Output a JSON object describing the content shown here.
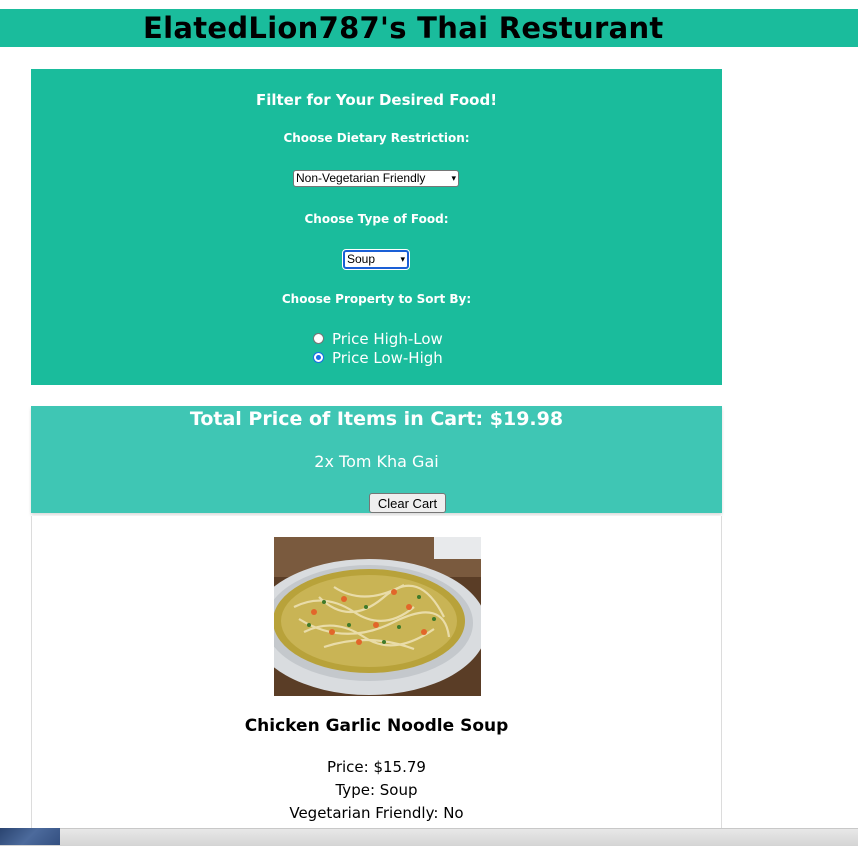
{
  "header": {
    "title": "ElatedLion787's Thai Resturant"
  },
  "filter": {
    "title": "Filter for Your Desired Food!",
    "diet_label": "Choose Dietary Restriction:",
    "diet_value": "Non-Vegetarian Friendly",
    "type_label": "Choose Type of Food:",
    "type_value": "Soup",
    "sort_label": "Choose Property to Sort By:",
    "sort_options": [
      {
        "label": "Price High-Low",
        "checked": false
      },
      {
        "label": "Price Low-High",
        "checked": true
      }
    ]
  },
  "cart": {
    "total": "Total Price of Items in Cart: $19.98",
    "items": [
      "2x Tom Kha Gai"
    ],
    "clear_label": "Clear Cart"
  },
  "food": {
    "name": "Chicken Garlic Noodle Soup",
    "price": "Price: $15.79",
    "type": "Type: Soup",
    "veg": "Vegetarian Friendly: No"
  },
  "colors": {
    "header_bg": "#1abc9c",
    "filter_bg": "#1abc9c",
    "cart_bg": "#3fc6b4",
    "focus": "#1a5fd6"
  }
}
